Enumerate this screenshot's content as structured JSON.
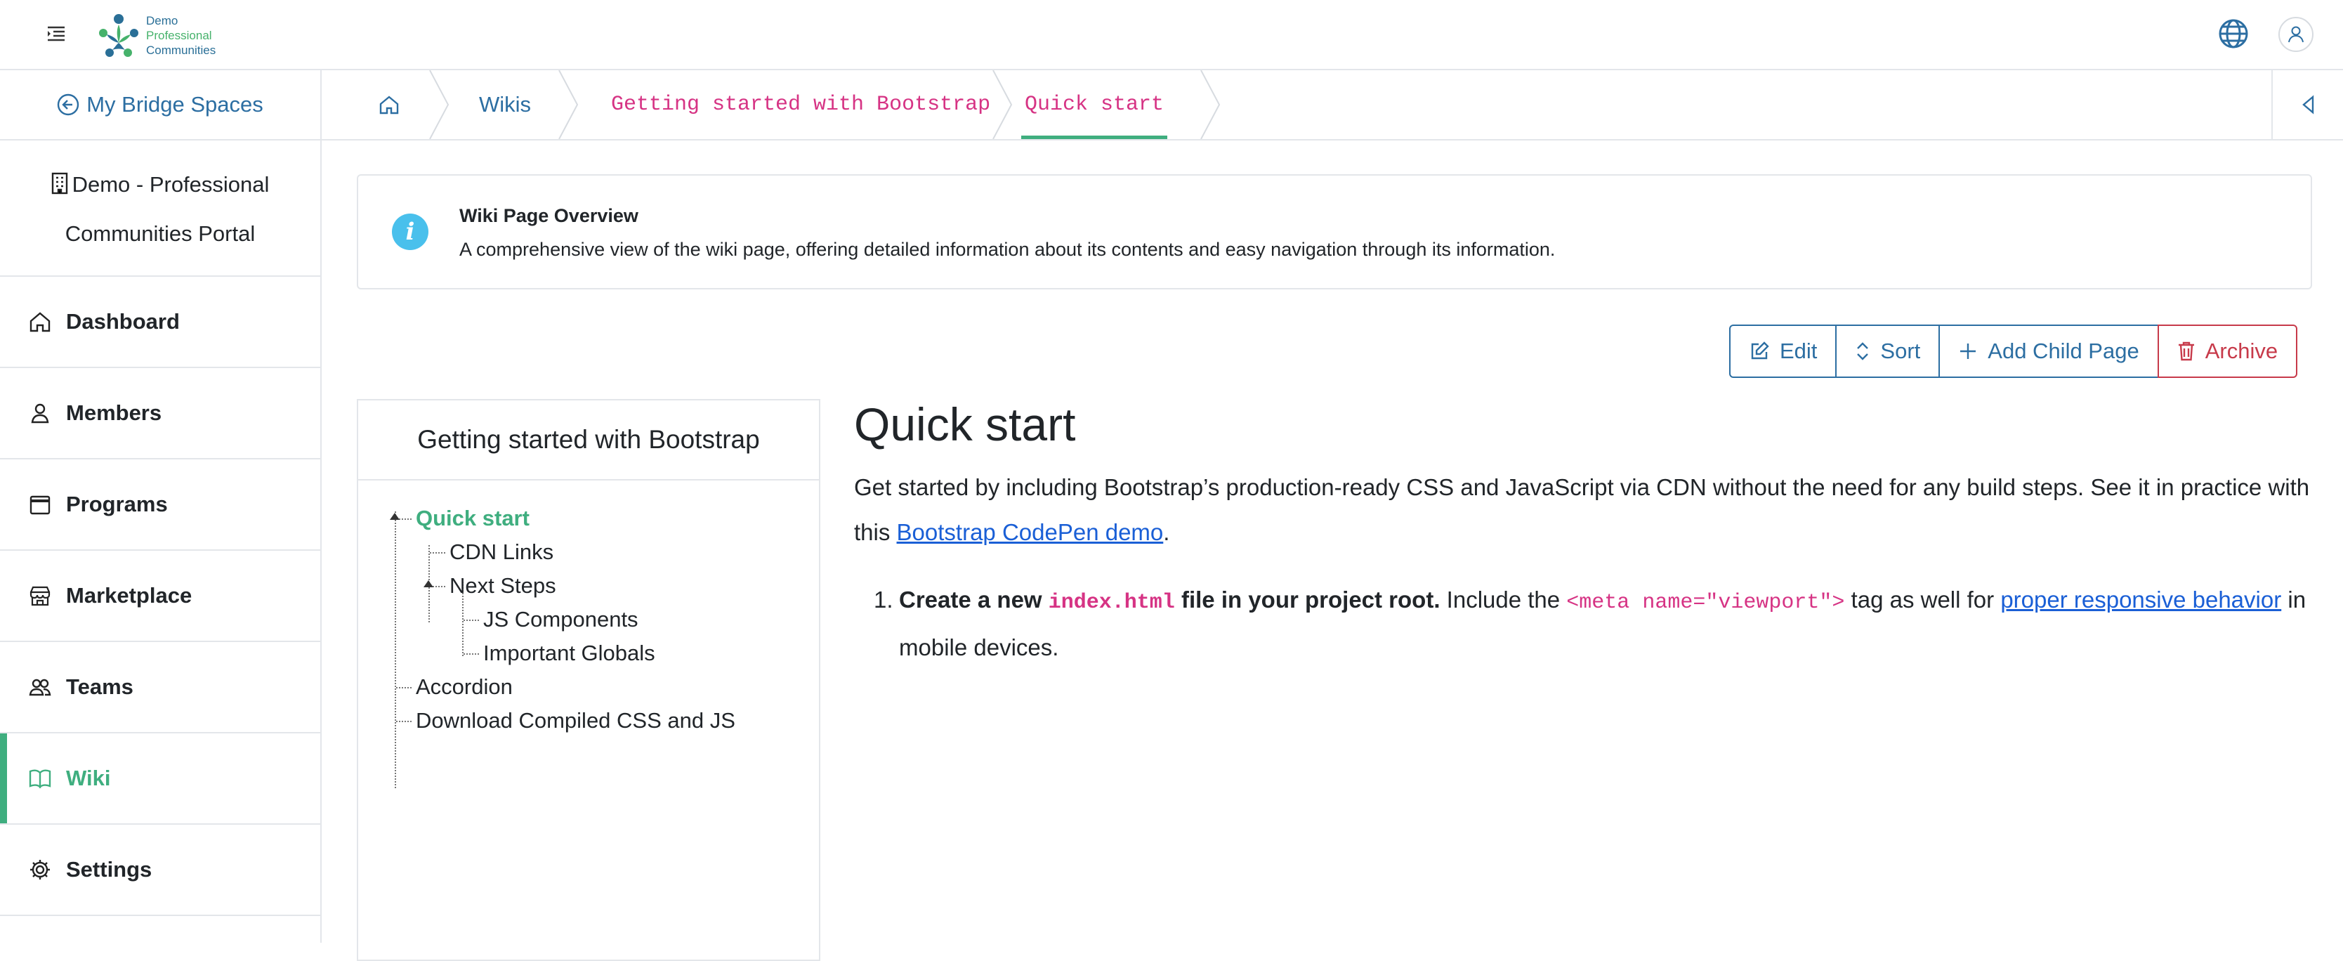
{
  "header": {
    "logo_lines": [
      "Demo",
      "Professional",
      "Communities"
    ]
  },
  "sidebar": {
    "back_label": "My Bridge Spaces",
    "org_line1": "Demo - Professional",
    "org_line2": "Communities Portal",
    "items": [
      {
        "label": "Dashboard",
        "icon": "home-icon"
      },
      {
        "label": "Members",
        "icon": "person-icon"
      },
      {
        "label": "Programs",
        "icon": "calendar-icon"
      },
      {
        "label": "Marketplace",
        "icon": "shop-icon"
      },
      {
        "label": "Teams",
        "icon": "people-icon"
      },
      {
        "label": "Wiki",
        "icon": "book-icon",
        "active": true
      },
      {
        "label": "Settings",
        "icon": "gear-icon"
      }
    ]
  },
  "breadcrumb": {
    "items": [
      "Wikis",
      "Getting started with Bootstrap",
      "Quick start"
    ]
  },
  "alert": {
    "title": "Wiki Page Overview",
    "text": "A comprehensive view of the wiki page, offering detailed information about its contents and easy navigation through its information."
  },
  "actions": {
    "edit": "Edit",
    "sort": "Sort",
    "add_child": "Add Child Page",
    "archive": "Archive"
  },
  "toc": {
    "title": "Getting started with Bootstrap",
    "nodes": [
      "Quick start",
      "CDN Links",
      "Next Steps",
      "JS Components",
      "Important Globals",
      "Accordion",
      "Download Compiled CSS and JS"
    ]
  },
  "content": {
    "title": "Quick start",
    "intro": "Get started by including Bootstrap’s production-ready CSS and JavaScript via CDN without the need for any build steps. See it in practice with this ",
    "intro_link": "Bootstrap CodePen demo",
    "intro_end": ".",
    "step_num": "1.",
    "step_bold_a": "Create a new ",
    "step_code_file": "index.html",
    "step_bold_b": " file in your project root.",
    "step_text_a": " Include the ",
    "step_code_meta": "<meta name=\"viewport\">",
    "step_text_b": " tag as well for ",
    "step_link": "proper responsive behavior",
    "step_text_c": " in mobile devices."
  },
  "colors": {
    "accent": "#3fae7f",
    "link": "#2c6ea2",
    "danger": "#c73a4a",
    "code": "#d63384"
  }
}
